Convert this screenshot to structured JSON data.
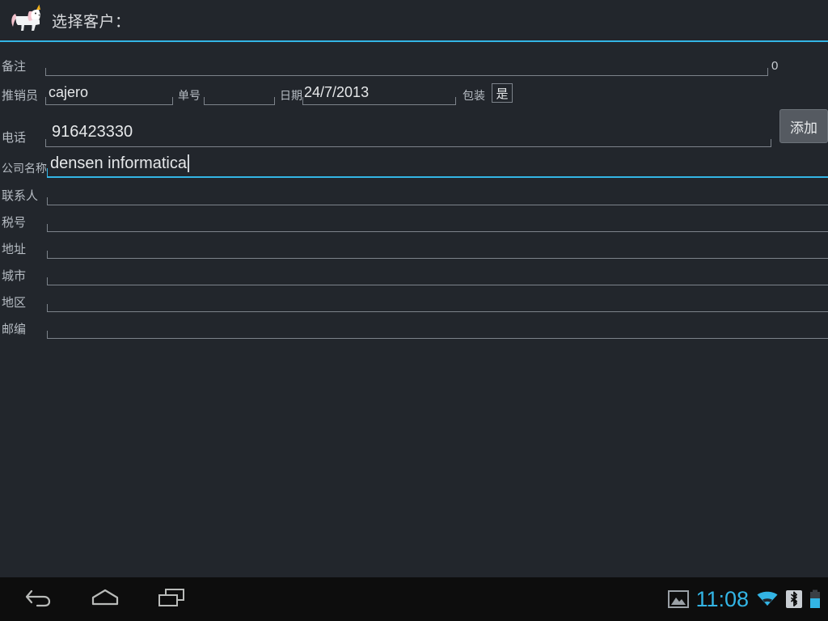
{
  "window": {
    "title": "选择客户：",
    "app_icon": "unicorn-icon",
    "accent_color": "#33b5e5",
    "background_color": "#22262c",
    "navbar_color": "#0d0d0d"
  },
  "form": {
    "rows": {
      "note": {
        "label": "备注",
        "value": "",
        "trailing_value": "0"
      },
      "salesperson": {
        "label": "推销员",
        "value": "cajero"
      },
      "order_no": {
        "label": "单号",
        "value": ""
      },
      "date": {
        "label": "日期",
        "value": "24/7/2013"
      },
      "packaging": {
        "label": "包装",
        "value": "是"
      },
      "phone": {
        "label": "电话",
        "value": "916423330"
      },
      "company_name": {
        "label": "公司名称",
        "value": "densen informatica",
        "focused": true
      },
      "contact": {
        "label": "联系人",
        "value": ""
      },
      "tax_id": {
        "label": "税号",
        "value": ""
      },
      "address": {
        "label": "地址",
        "value": ""
      },
      "city": {
        "label": "城市",
        "value": ""
      },
      "district": {
        "label": "地区",
        "value": ""
      },
      "postcode": {
        "label": "邮编",
        "value": ""
      }
    },
    "add_button_label": "添加"
  },
  "navbar": {
    "back_icon": "back-arrow-icon",
    "home_icon": "home-icon",
    "recents_icon": "recent-apps-icon",
    "screenshot_icon": "image-icon",
    "clock": "11:08",
    "wifi_icon": "wifi-icon",
    "bluetooth_icon": "bluetooth-icon",
    "battery_icon": "battery-icon"
  }
}
